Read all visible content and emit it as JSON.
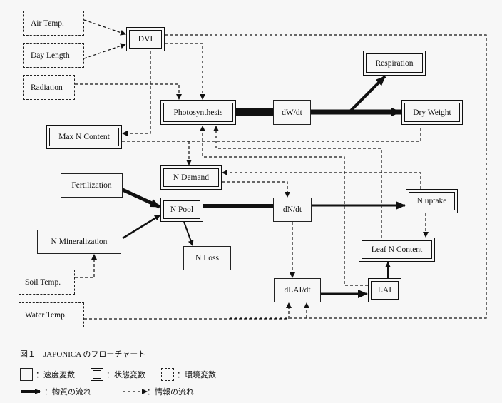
{
  "nodes": {
    "air_temp": "Air Temp.",
    "day_length": "Day Length",
    "radiation": "Radiation",
    "dvi": "DVI",
    "photosynthesis": "Photosynthesis",
    "dw_dt": "dW/dt",
    "respiration": "Respiration",
    "dry_weight": "Dry Weight",
    "max_n_content": "Max N Content",
    "n_demand": "N Demand",
    "fertilization": "Fertilization",
    "n_pool": "N Pool",
    "dn_dt": "dN/dt",
    "n_uptake": "N uptake",
    "n_mineralization": "N Mineralization",
    "n_loss": "N Loss",
    "leaf_n_content": "Leaf N Content",
    "soil_temp": "Soil Temp.",
    "dlai_dt": "dLAI/dt",
    "lai": "LAI",
    "water_temp": "Water Temp."
  },
  "caption": "図１　JAPONICA のフローチャート",
  "legend": {
    "rate_variable": "：速度変数",
    "state_variable": "：状態変数",
    "environment_variable": "：環境変数",
    "material_flow": "：物質の流れ",
    "information_flow": "：情報の流れ"
  }
}
